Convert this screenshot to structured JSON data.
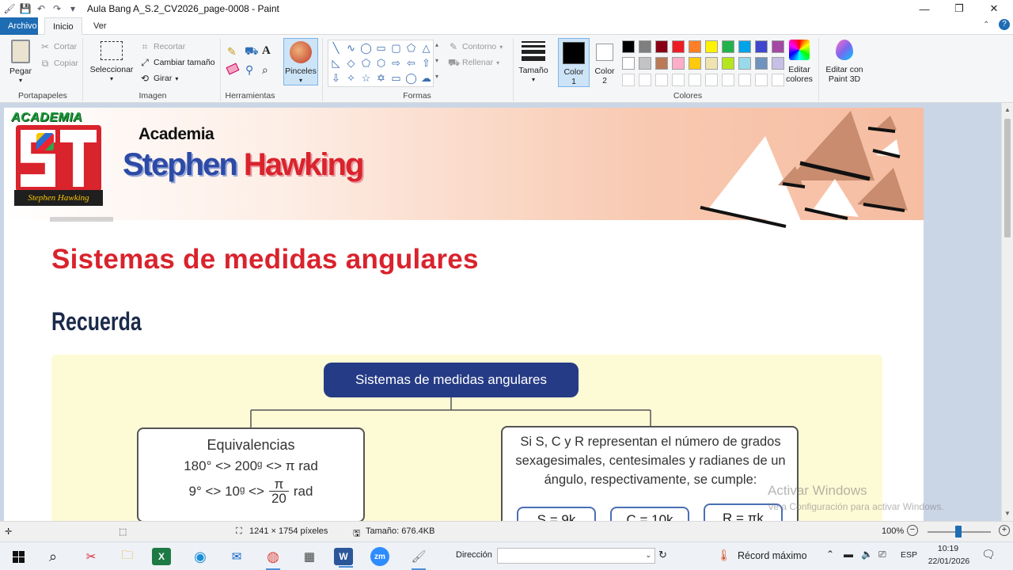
{
  "window": {
    "title": "Aula Bang A_S.2_CV2026_page-0008 - Paint",
    "minimize": "—",
    "maximize": "❐",
    "close": "✕"
  },
  "tabs": [
    "Archivo",
    "Inicio",
    "Ver"
  ],
  "ribbon": {
    "portapapeles": {
      "label": "Portapapeles",
      "pegar": "Pegar",
      "cortar": "Cortar",
      "copiar": "Copiar"
    },
    "imagen": {
      "label": "Imagen",
      "seleccionar": "Seleccionar",
      "recortar": "Recortar",
      "cambiar_tamano": "Cambiar tamaño",
      "girar": "Girar"
    },
    "herramientas": {
      "label": "Herramientas"
    },
    "pinceles": "Pinceles",
    "formas": {
      "label": "Formas",
      "contorno": "Contorno",
      "rellenar": "Rellenar"
    },
    "tamano": "Tamaño",
    "color1": [
      "Color",
      "1"
    ],
    "color2": [
      "Color",
      "2"
    ],
    "colores": {
      "label": "Colores",
      "editar": [
        "Editar",
        "colores"
      ]
    },
    "paint3d": [
      "Editar con",
      "Paint 3D"
    ]
  },
  "palette_row1": [
    "#000000",
    "#7f7f7f",
    "#880015",
    "#ed1c24",
    "#ff7f27",
    "#fff200",
    "#22b14c",
    "#00a2e8",
    "#3f48cc",
    "#a349a4"
  ],
  "palette_row2": [
    "#ffffff",
    "#c3c3c3",
    "#b97a57",
    "#ffaec9",
    "#ffc90e",
    "#efe4b0",
    "#b5e61d",
    "#99d9ea",
    "#7092be",
    "#c8bfe7"
  ],
  "document": {
    "academia_logo": "ACADEMIA",
    "logo_sub": "Stephen Hawking",
    "brand_small": "Academia",
    "brand_stephen": "Stephen",
    "brand_hawking": "Hawking",
    "heading": "Sistemas de medidas angulares",
    "recuerda": "Recuerda",
    "box_title": "Sistemas de medidas angulares",
    "equiv_title": "Equivalencias",
    "equiv_line1": "180° <> 200ᵍ <> π rad",
    "equiv_line2_a": "9° <> 10ᵍ <>",
    "equiv_frac_num": "π",
    "equiv_frac_den": "20",
    "equiv_line2_b": "rad",
    "right_text": "Si S, C y R representan el número de grados sexagesimales, centesimales y radianes de un ángulo, respectivamente, se cumple:",
    "formula_s": "S = 9k",
    "formula_c": "C = 10k",
    "formula_r": "R = πk"
  },
  "watermark": {
    "line1": "Activar Windows",
    "line2": "Ve a Configuración para activar Windows."
  },
  "status": {
    "dimensions": "1241 × 1754 píxeles",
    "size": "Tamaño: 676.4KB",
    "zoom": "100%"
  },
  "taskbar": {
    "direccion": "Dirección",
    "record": "Récord máximo",
    "lang": "ESP",
    "time": "10:19",
    "date": "22/01/2026"
  }
}
